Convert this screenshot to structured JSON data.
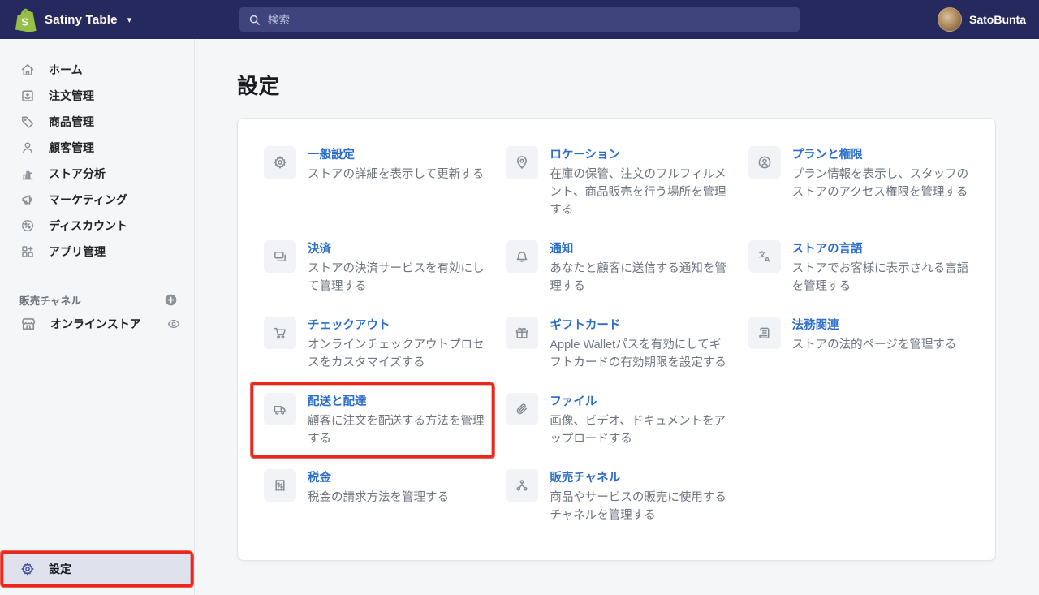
{
  "topbar": {
    "store_name": "Satiny Table",
    "search_placeholder": "検索",
    "user_name": "SatoBunta",
    "logo_icon": "shopify-logo",
    "caret_icon": "caret-down-icon"
  },
  "sidebar": {
    "items": [
      {
        "label": "ホーム",
        "icon": "home-icon"
      },
      {
        "label": "注文管理",
        "icon": "orders-icon"
      },
      {
        "label": "商品管理",
        "icon": "products-icon"
      },
      {
        "label": "顧客管理",
        "icon": "customers-icon"
      },
      {
        "label": "ストア分析",
        "icon": "analytics-icon"
      },
      {
        "label": "マーケティング",
        "icon": "marketing-icon"
      },
      {
        "label": "ディスカウント",
        "icon": "discounts-icon"
      },
      {
        "label": "アプリ管理",
        "icon": "apps-icon"
      }
    ],
    "sales_channels": {
      "header": "販売チャネル",
      "add_icon": "plus-circle-icon",
      "items": [
        {
          "label": "オンラインストア",
          "icon": "storefront-icon",
          "trailing_icon": "eye-icon"
        }
      ]
    },
    "settings": {
      "label": "設定",
      "icon": "gear-icon",
      "selected": true,
      "annotated": true
    }
  },
  "main": {
    "page_title": "設定",
    "cards_rows": [
      [
        {
          "icon": "gear-icon",
          "title": "一般設定",
          "description": "ストアの詳細を表示して更新する"
        },
        {
          "icon": "location-icon",
          "title": "ロケーション",
          "description": "在庫の保管、注文のフルフィルメント、商品販売を行う場所を管理する"
        },
        {
          "icon": "person-circle-icon",
          "title": "プランと権限",
          "description": "プラン情報を表示し、スタッフのストアのアクセス権限を管理する"
        }
      ],
      [
        {
          "icon": "payment-cards-icon",
          "title": "決済",
          "description": "ストアの決済サービスを有効にして管理する"
        },
        {
          "icon": "bell-icon",
          "title": "通知",
          "description": "あなたと顧客に送信する通知を管理する"
        },
        {
          "icon": "language-icon",
          "title": "ストアの言語",
          "description": "ストアでお客様に表示される言語を管理する"
        }
      ],
      [
        {
          "icon": "cart-icon",
          "title": "チェックアウト",
          "description": "オンラインチェックアウトプロセスをカスタマイズする"
        },
        {
          "icon": "gift-icon",
          "title": "ギフトカード",
          "description": "Apple Walletパスを有効にしてギフトカードの有効期限を設定する"
        },
        {
          "icon": "scroll-icon",
          "title": "法務関連",
          "description": "ストアの法的ページを管理する"
        }
      ],
      [
        {
          "icon": "truck-icon",
          "title": "配送と配達",
          "description": "顧客に注文を配送する方法を管理する",
          "annotated": true
        },
        {
          "icon": "paperclip-icon",
          "title": "ファイル",
          "description": "画像、ビデオ、ドキュメントをアップロードする"
        }
      ],
      [
        {
          "icon": "receipt-percent-icon",
          "title": "税金",
          "description": "税金の請求方法を管理する"
        },
        {
          "icon": "network-icon",
          "title": "販売チャネル",
          "description": "商品やサービスの販売に使用するチャネルを管理する"
        }
      ]
    ]
  },
  "colors": {
    "topbar_bg": "#25295e",
    "accent_link": "#2c6ecb",
    "annotation_red": "#e8281c",
    "shopify_green": "#95bf47",
    "selected_item_bg": "#dfe2ec"
  }
}
